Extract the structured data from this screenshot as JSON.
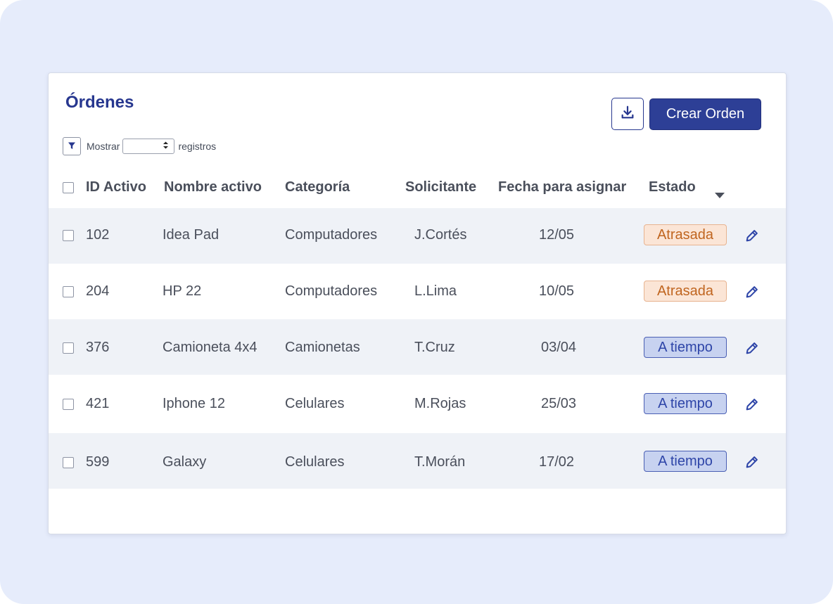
{
  "page": {
    "title": "Órdenes"
  },
  "toolbar": {
    "create_label": "Crear Orden",
    "download_icon": "download-icon"
  },
  "show_entries": {
    "prefix": "Mostrar",
    "suffix": "registros",
    "selected_value": "",
    "filter_icon": "filter-icon"
  },
  "table": {
    "columns": [
      "ID Activo",
      "Nombre activo",
      "Categoría",
      "Solicitante",
      "Fecha para asignar",
      "Estado"
    ],
    "rows": [
      {
        "id": "102",
        "name": "Idea Pad",
        "category": "Computadores",
        "requester": "J.Cortés",
        "date": "12/05",
        "status": "Atrasada",
        "status_type": "late"
      },
      {
        "id": "204",
        "name": "HP 22",
        "category": "Computadores",
        "requester": "L.Lima",
        "date": "10/05",
        "status": "Atrasada",
        "status_type": "late"
      },
      {
        "id": "376",
        "name": "Camioneta 4x4",
        "category": "Camionetas",
        "requester": "T.Cruz",
        "date": "03/04",
        "status": "A tiempo",
        "status_type": "ontime"
      },
      {
        "id": "421",
        "name": "Iphone 12",
        "category": "Celulares",
        "requester": "M.Rojas",
        "date": "25/03",
        "status": "A tiempo",
        "status_type": "ontime"
      },
      {
        "id": "599",
        "name": "Galaxy",
        "category": "Celulares",
        "requester": "T.Morán",
        "date": "17/02",
        "status": "A tiempo",
        "status_type": "ontime"
      }
    ]
  },
  "colors": {
    "accent": "#2d3f96",
    "title": "#27378f",
    "late_bg": "#fbe5d6",
    "late_text": "#c0651f",
    "ontime_bg": "#c7d2f0",
    "ontime_text": "#2e45a8",
    "shaded_row": "#eff2f7"
  }
}
